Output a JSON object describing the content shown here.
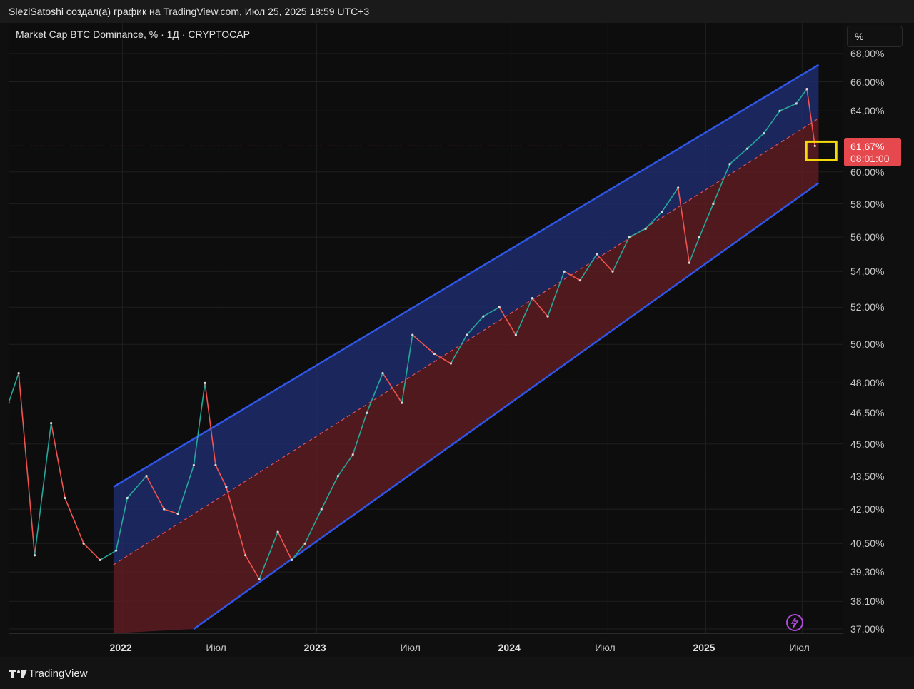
{
  "header": {
    "attribution": "SleziSatoshi создал(а) график на TradingView.com, Июл 25, 2025 18:59 UTC+3"
  },
  "legend": {
    "title": "Market Cap BTC Dominance, % · 1Д · CRYPTOCAP"
  },
  "scale_toggle": {
    "label": "%"
  },
  "price_tag": {
    "price": "61,67%",
    "countdown": "08:01:00",
    "color": "#e5484d"
  },
  "footer": {
    "brand": "TradingView"
  },
  "chart_data": {
    "type": "line",
    "y_scale": "log",
    "y_ticks": [
      "68,00%",
      "66,00%",
      "64,00%",
      "60,00%",
      "58,00%",
      "56,00%",
      "54,00%",
      "52,00%",
      "50,00%",
      "48,00%",
      "46,50%",
      "45,00%",
      "43,50%",
      "42,00%",
      "40,50%",
      "39,30%",
      "38,10%",
      "37,00%"
    ],
    "y_tick_values": [
      68,
      66,
      64,
      60,
      58,
      56,
      54,
      52,
      50,
      48,
      46.5,
      45,
      43.5,
      42,
      40.5,
      39.3,
      38.1,
      37
    ],
    "ylim": [
      37,
      68
    ],
    "x_ticks": [
      "2022",
      "Июл",
      "2023",
      "Июл",
      "2024",
      "Июл",
      "2025",
      "Июл"
    ],
    "x_tick_dates": [
      "2022-01-01",
      "2022-07-01",
      "2023-01-01",
      "2023-07-01",
      "2024-01-01",
      "2024-07-01",
      "2025-01-01",
      "2025-07-01"
    ],
    "xlim": [
      "2021-06-01",
      "2025-09-15"
    ],
    "series": [
      {
        "x": [
          "2021-06-01",
          "2021-06-20",
          "2021-07-20",
          "2021-08-20",
          "2021-09-15",
          "2021-10-20",
          "2021-11-20",
          "2021-12-20",
          "2022-01-10",
          "2022-02-15",
          "2022-03-20",
          "2022-04-15",
          "2022-05-15",
          "2022-06-05",
          "2022-06-25",
          "2022-07-15",
          "2022-08-20",
          "2022-09-15",
          "2022-10-20",
          "2022-11-15",
          "2022-12-10",
          "2023-01-10",
          "2023-02-10",
          "2023-03-10",
          "2023-04-05",
          "2023-05-05",
          "2023-06-10",
          "2023-06-30",
          "2023-08-10",
          "2023-09-10",
          "2023-10-10",
          "2023-11-10",
          "2023-12-10",
          "2024-01-10",
          "2024-02-10",
          "2024-03-10",
          "2024-04-10",
          "2024-05-10",
          "2024-06-10",
          "2024-07-10",
          "2024-08-10",
          "2024-09-10",
          "2024-10-10",
          "2024-11-10",
          "2024-12-01",
          "2024-12-20",
          "2025-01-15",
          "2025-02-15",
          "2025-03-20",
          "2025-04-20",
          "2025-05-20",
          "2025-06-20",
          "2025-07-10",
          "2025-07-25"
        ],
        "values": [
          47.0,
          48.5,
          40.0,
          46.0,
          42.5,
          40.5,
          39.8,
          40.2,
          42.5,
          43.5,
          42.0,
          41.8,
          44.0,
          48.0,
          44.0,
          43.0,
          40.0,
          39.0,
          41.0,
          39.8,
          40.5,
          42.0,
          43.5,
          44.5,
          46.5,
          48.5,
          47.0,
          50.5,
          49.5,
          49.0,
          50.5,
          51.5,
          52.0,
          50.5,
          52.5,
          51.5,
          54.0,
          53.5,
          55.0,
          54.0,
          56.0,
          56.5,
          57.5,
          59.0,
          54.5,
          56.0,
          58.0,
          60.5,
          61.5,
          62.5,
          64.0,
          64.5,
          65.5,
          61.67
        ]
      }
    ],
    "channel": {
      "upper": {
        "x": [
          "2021-12-15",
          "2025-08-01"
        ],
        "y": [
          43.0,
          67.2
        ]
      },
      "middle": {
        "x": [
          "2021-12-15",
          "2025-08-01"
        ],
        "y": [
          39.6,
          63.5
        ]
      },
      "lower": {
        "x": [
          "2022-05-15",
          "2025-08-01"
        ],
        "y": [
          37.0,
          59.3
        ]
      },
      "upper_fill": "#1e2d6b",
      "lower_fill": "#5c1c22",
      "line_color": "#2f55e6"
    },
    "current_price_line": 61.67
  }
}
